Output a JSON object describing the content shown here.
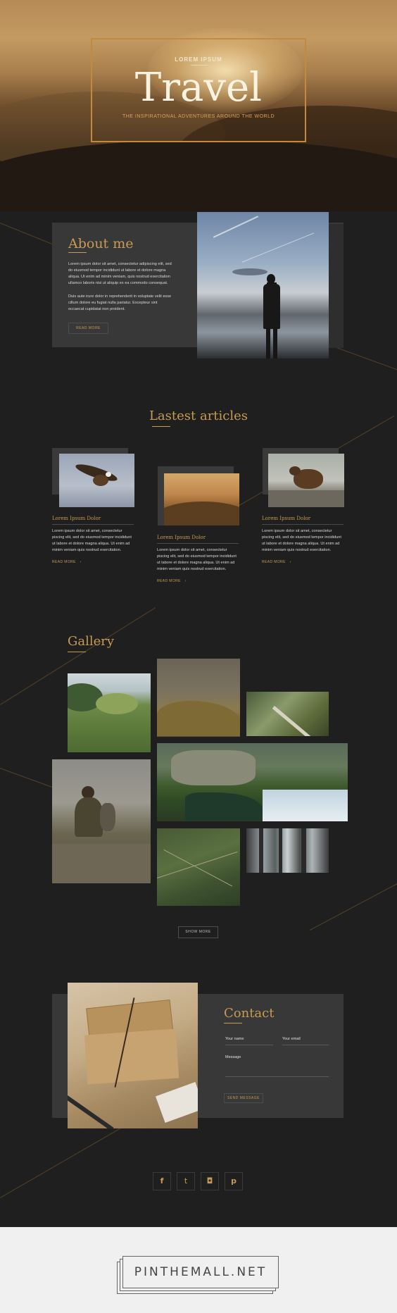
{
  "hero": {
    "kicker": "LOREM IPSUM",
    "title": "Travel",
    "subtitle": "THE INSPIRATIONAL ADVENTURES AROUND THE WORLD"
  },
  "about": {
    "title": "About me",
    "paragraph1": "Lorem ipsum dolor sit amet, consectetur adipiscing elit, sed do eiusmod tempor incididunt ut labore et dolore magna aliqua. Ut enim ad minim veniam, quis nostrud exercitation ullamco laboris nisi ut aliquip ex ea commodo consequat.",
    "paragraph2": "Duis aute irure dolor in reprehenderit in voluptate velit esse cillum dolore eu fugiat nulla pariatur. Excepteur sint occaecat cupidatat non proident.",
    "button": "READ MORE"
  },
  "articles": {
    "title": "Lastest articles",
    "items": [
      {
        "title": "Lorem Ipsum Dolor",
        "text": "Lorem ipsum dolor sit amet, consectetur piscing elit, sed do eiusmod tempor incididunt ut labore et dolore magna aliqua. Ut enim ad minim veniam quis nostrud exercitation.",
        "more": "READ MORE",
        "arrow": "›"
      },
      {
        "title": "Lorem Ipsum Dolor",
        "text": "Lorem ipsum dolor sit amet, consectetur piscing elit, sed do eiusmod tempor incididunt ut labore et dolore magna aliqua. Ut enim ad minim veniam quis nostrud exercitation.",
        "more": "READ MORE",
        "arrow": "›"
      },
      {
        "title": "Lorem Ipsum Dolor",
        "text": "Lorem ipsum dolor sit amet, consectetur piscing elit, sed do eiusmod tempor incididunt ut labore et dolore magna aliqua. Ut enim ad minim veniam quis nostrud exercitation.",
        "more": "READ MORE",
        "arrow": "›"
      }
    ]
  },
  "gallery": {
    "title": "Gallery",
    "button": "SHOW MORE"
  },
  "contact": {
    "title": "Contact",
    "name_label": "Your name",
    "email_label": "Your email",
    "message_label": "Message",
    "button": "SEND MESSAGE"
  },
  "social": [
    {
      "icon": "facebook-icon",
      "glyph": "f"
    },
    {
      "icon": "twitter-icon",
      "glyph": "t"
    },
    {
      "icon": "instagram-icon",
      "glyph": "◘"
    },
    {
      "icon": "pinterest-icon",
      "glyph": "p"
    }
  ],
  "footer": {
    "logo": "PINTHEMALL.NET"
  },
  "colors": {
    "accent": "#c89a52",
    "background": "#1f1f1f",
    "panel": "#383838"
  }
}
